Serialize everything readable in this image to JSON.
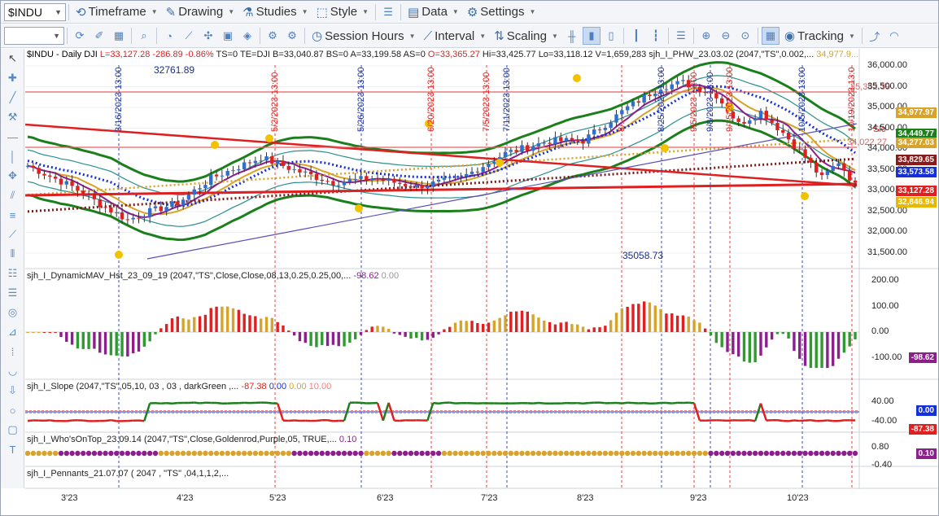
{
  "toolbar": {
    "symbol": "$INDU",
    "timeframe": "Timeframe",
    "drawing": "Drawing",
    "studies": "Studies",
    "style": "Style",
    "data": "Data",
    "settings": "Settings",
    "session_hours": "Session Hours",
    "interval": "Interval",
    "scaling": "Scaling",
    "tracking": "Tracking"
  },
  "colors": {
    "up": "#2f9a2f",
    "down": "#e02020",
    "goldenrod": "#d7a32a",
    "purple": "#8b1f8b",
    "blue": "#1530d8",
    "darkgreen": "#1b7f1b",
    "teal": "#2a8f8f"
  },
  "price_pane": {
    "header": {
      "name": "$INDU - Daily  DJI",
      "L": "L=33,127.28",
      "chg": "-286.89",
      "pct": "-0.86%",
      "ts": "TS=0",
      "te": "TE=DJI",
      "b": "B=33,040.87",
      "bs": "BS=0",
      "a": "A=33,199.58",
      "as": "AS=0",
      "o": "O=33,365.27",
      "hi": "Hi=33,425.77",
      "lo": "Lo=33,118.12",
      "v": "V=1,659,283",
      "study": "sjh_I_PHW_23.03.02 (2047,\"TS\",0.002,...",
      "study_val": "34,977.9..."
    },
    "annotations": {
      "low_val": "32761.89",
      "mid_val": "35058.73",
      "top_red": "35,352.39",
      "mid_red": "34,022.27",
      "slo": "Slo"
    },
    "y_ticks": [
      "36,000.00",
      "35,500.00",
      "35,000.00",
      "34,500.00",
      "34,000.00",
      "33,500.00",
      "33,000.00",
      "32,500.00",
      "32,000.00",
      "31,500.00"
    ],
    "tags": [
      {
        "text": "34,977.97",
        "color": "#d7a32a"
      },
      {
        "text": "34,449.77",
        "color": "#1b7f1b"
      },
      {
        "text": "34,277.03",
        "color": "#d7a32a"
      },
      {
        "text": "33,829.65",
        "color": "#8b1a1a"
      },
      {
        "text": "33,573.58",
        "color": "#1530d8"
      },
      {
        "text": "33,127.28",
        "color": "#e02020"
      },
      {
        "text": "32,846.94",
        "color": "#e6b800"
      }
    ],
    "date_markers": [
      "3/16/2023 13:00",
      "5/2/2023 13:00",
      "5/26/2023 13:00",
      "6/20/2023 13:00",
      "7/5/2023 13:00",
      "7/11/2023 13:00",
      "8/...",
      "8/25/2023 13:00",
      "9/5/2023 13:00",
      "9/8/2023 13:00",
      "9/15/2023 13:00",
      "10/5/2023 13:00",
      "10/19/2023 13:00"
    ]
  },
  "dmav_pane": {
    "title": "sjh_I_DynamicMAV_Hst_23_09_19 (2047,\"TS\",Close,Close,08,13,0.25,0.25,00,...",
    "val1": "-98.62",
    "val2": "0.00",
    "y_ticks": [
      "200.00",
      "100.00",
      "0.00",
      "-100.00"
    ],
    "tag": "-98.62"
  },
  "slope_pane": {
    "title": "sjh_I_Slope (2047,\"TS\",05,10, 03 , 03 , darkGreen ,...",
    "v1": "-87.38",
    "v2": "0.00",
    "v3": "0.00",
    "v4": "10.00",
    "y_ticks": [
      "40.00",
      "-40.00"
    ],
    "tags": [
      "0.00",
      "-87.38"
    ]
  },
  "wot_pane": {
    "title": "sjh_I_Who'sOnTop_23.09.14 (2047,\"TS\",Close,Goldenrod,Purple,05,  TRUE,...",
    "val": "0.10",
    "y_ticks": [
      "0.80",
      "-0.40"
    ],
    "tag": "0.10"
  },
  "pennant_pane": {
    "title": "sjh_I_Pennants_21.07.07 (  2047 ,  \"TS\" ,04,1,1,2,..."
  },
  "x_axis": [
    "3'23",
    "4'23",
    "5'23",
    "6'23",
    "7'23",
    "8'23",
    "9'23",
    "10'23"
  ]
}
